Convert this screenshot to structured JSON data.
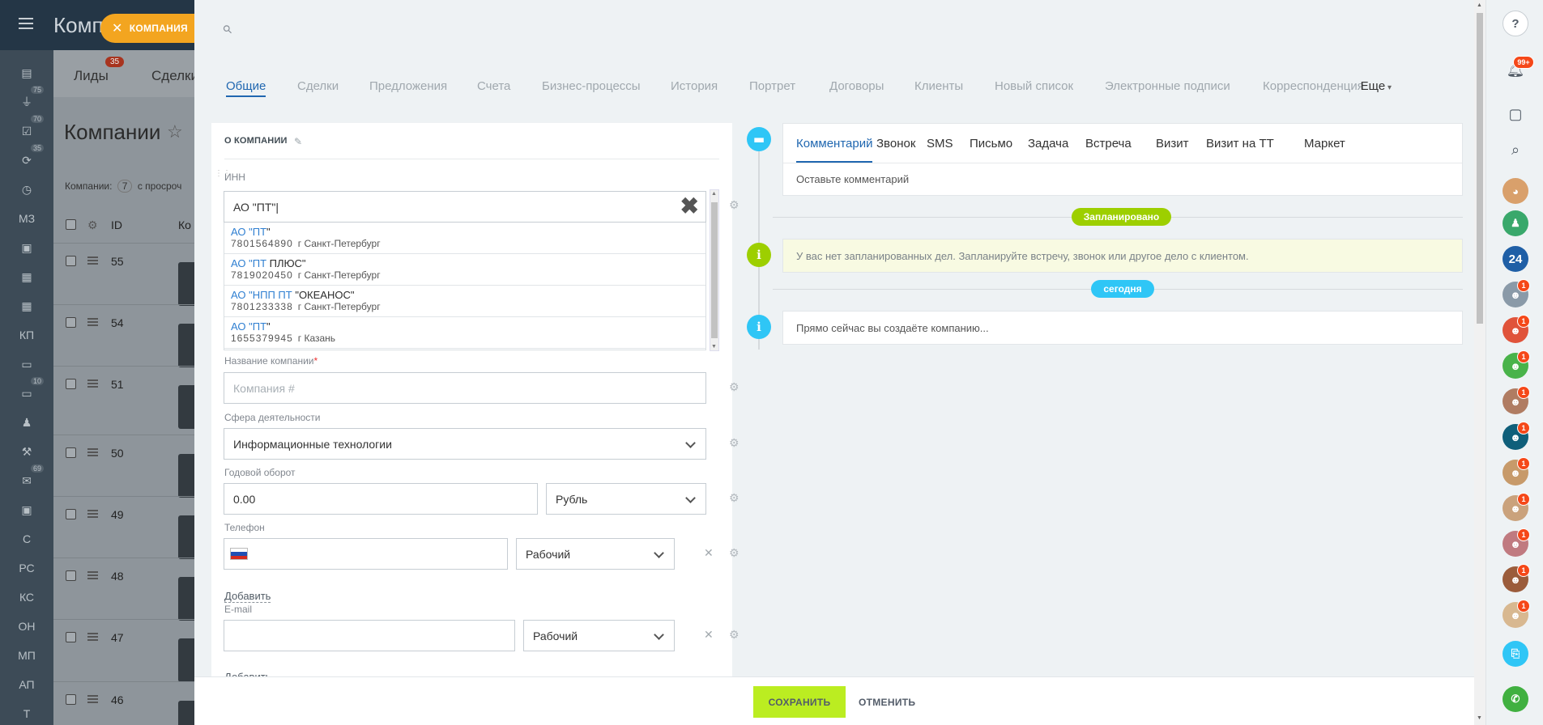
{
  "background": {
    "title_top": "Компа",
    "page_title": "Компании",
    "tabs": [
      {
        "label": "Лиды",
        "badge": "35"
      },
      {
        "label": "Сделки",
        "badge": ""
      }
    ],
    "summary": {
      "prefix": "Компании:",
      "count": "7",
      "suffix": "с просроч"
    },
    "columns": {
      "id": "ID",
      "company": "Ко"
    },
    "rows": [
      "55",
      "54",
      "51",
      "50",
      "49",
      "48",
      "47",
      "46"
    ],
    "nav": [
      {
        "label": "",
        "icon": "list-icon",
        "badge": ""
      },
      {
        "label": "",
        "icon": "filter-icon",
        "badge": "75"
      },
      {
        "label": "",
        "icon": "check-icon",
        "badge": "70"
      },
      {
        "label": "",
        "icon": "refresh-icon",
        "badge": "35"
      },
      {
        "label": "",
        "icon": "clock-icon",
        "badge": ""
      },
      {
        "label": "МЗ",
        "icon": "",
        "badge": ""
      },
      {
        "label": "",
        "icon": "contact-card-icon",
        "badge": ""
      },
      {
        "label": "",
        "icon": "building-icon",
        "badge": ""
      },
      {
        "label": "",
        "icon": "calendar-icon",
        "badge": ""
      },
      {
        "label": "КП",
        "icon": "",
        "badge": ""
      },
      {
        "label": "",
        "icon": "printer-icon",
        "badge": ""
      },
      {
        "label": "",
        "icon": "chat-icon",
        "badge": "10"
      },
      {
        "label": "",
        "icon": "people-icon",
        "badge": ""
      },
      {
        "label": "",
        "icon": "wrench-icon",
        "badge": ""
      },
      {
        "label": "",
        "icon": "mail-icon",
        "badge": "69"
      },
      {
        "label": "",
        "icon": "box-icon",
        "badge": ""
      },
      {
        "label": "С",
        "icon": "",
        "badge": ""
      },
      {
        "label": "РС",
        "icon": "",
        "badge": ""
      },
      {
        "label": "КС",
        "icon": "",
        "badge": ""
      },
      {
        "label": "ОН",
        "icon": "",
        "badge": ""
      },
      {
        "label": "МП",
        "icon": "",
        "badge": ""
      },
      {
        "label": "АП",
        "icon": "",
        "badge": ""
      },
      {
        "label": "Т",
        "icon": "",
        "badge": ""
      }
    ]
  },
  "chip": {
    "label": "КОМПАНИЯ"
  },
  "tabs": [
    {
      "label": "Общие",
      "active": true
    },
    {
      "label": "Сделки"
    },
    {
      "label": "Предложения"
    },
    {
      "label": "Счета"
    },
    {
      "label": "Бизнес-процессы"
    },
    {
      "label": "История"
    },
    {
      "label": "Портрет"
    },
    {
      "label": "Договоры"
    },
    {
      "label": "Клиенты"
    },
    {
      "label": "Новый список"
    },
    {
      "label": "Электронные подписи"
    },
    {
      "label": "Корреспонденция"
    }
  ],
  "more_tab": "Еще",
  "card": {
    "title": "О КОМПАНИИ",
    "inn": {
      "label": "ИНН",
      "value": "АО \"ПТ\"|"
    },
    "suggestions": [
      {
        "prefix": "АО \"",
        "hl": "ПТ",
        "suffix": "\"",
        "inn": "7801564890",
        "city": "г Санкт-Петербург"
      },
      {
        "prefix": "АО \"",
        "hl": "ПТ",
        "suffix": " ПЛЮС\"",
        "inn": "7819020450",
        "city": "г Санкт-Петербург"
      },
      {
        "prefix": "АО \"НПП ",
        "hl": "ПТ",
        "suffix": " \"ОКЕАНОС\"",
        "inn": "7801233338",
        "city": "г Санкт-Петербург"
      },
      {
        "prefix": "АО \"",
        "hl": "ПТ",
        "suffix": "\"",
        "inn": "1655379945",
        "city": "г Казань"
      }
    ],
    "company_name": {
      "label": "Название компании",
      "required": "*",
      "placeholder": "Компания #"
    },
    "industry": {
      "label": "Сфера деятельности",
      "value": "Информационные технологии"
    },
    "revenue": {
      "label": "Годовой оборот",
      "value": "0.00",
      "currency": "Рубль"
    },
    "phone": {
      "label": "Телефон",
      "type": "Рабочий",
      "add": "Добавить"
    },
    "email": {
      "label": "E-mail",
      "type": "Рабочий",
      "add": "Добавить"
    }
  },
  "timeline": {
    "editor_tabs": [
      {
        "label": "Комментарий",
        "active": true
      },
      {
        "label": "Звонок"
      },
      {
        "label": "SMS"
      },
      {
        "label": "Письмо"
      },
      {
        "label": "Задача"
      },
      {
        "label": "Встреча"
      },
      {
        "label": "Визит"
      },
      {
        "label": "Визит на ТТ"
      },
      {
        "label": "Маркет"
      }
    ],
    "editor_placeholder": "Оставьте комментарий",
    "planned_pill": "Запланировано",
    "planned_text": "У вас нет запланированных дел. Запланируйте встречу, звонок или другое дело с клиентом.",
    "today_pill": "сегодня",
    "today_text": "Прямо сейчас вы создаёте компанию...",
    "colors": {
      "planned": "#9dcf00",
      "today": "#2fc6f6",
      "blue_icon": "#2fc6f6",
      "green_icon": "#9dcf00"
    }
  },
  "footer": {
    "save": "СОХРАНИТЬ",
    "cancel": "ОТМЕНИТЬ"
  },
  "right_bar": {
    "notifications_badge": "99+",
    "counter_avatar": "24",
    "contact_badges": [
      "1",
      "1",
      "1",
      "1",
      "1",
      "1",
      "1",
      "1",
      "1",
      "1"
    ]
  }
}
